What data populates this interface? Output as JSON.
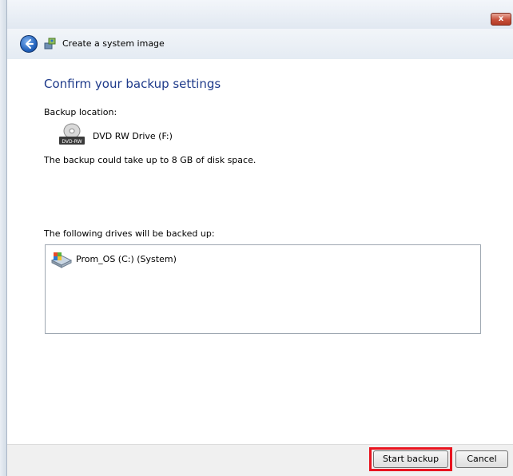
{
  "window": {
    "close_label": "x"
  },
  "nav": {
    "title": "Create a system image"
  },
  "page": {
    "heading": "Confirm your backup settings",
    "location_label": "Backup location:",
    "location_device": "DVD RW Drive (F:)",
    "location_icon_badge": "DVD-RW",
    "space_text": "The backup could take up to 8 GB of disk space.",
    "drives_label": "The following drives will be backed up:",
    "drives": [
      {
        "label": "Prom_OS (C:) (System)",
        "icon": "hard-drive-icon"
      }
    ]
  },
  "footer": {
    "start_label": "Start backup",
    "cancel_label": "Cancel",
    "highlight_color": "#e8141f"
  }
}
